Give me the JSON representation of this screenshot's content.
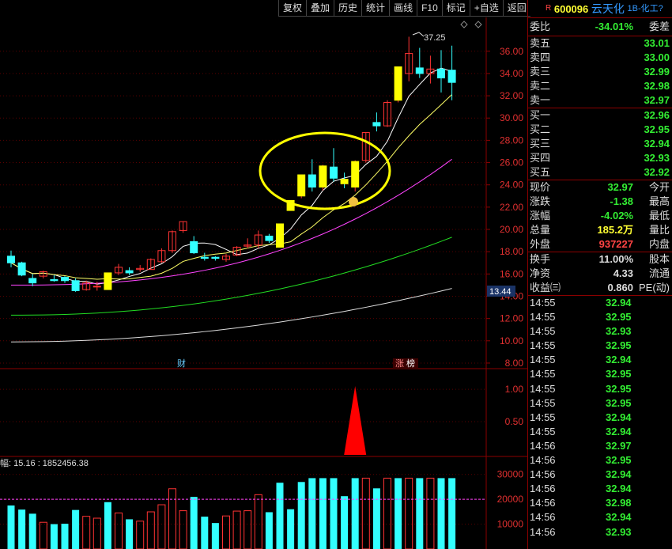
{
  "toolbar": {
    "buttons": [
      "复权",
      "叠加",
      "历史",
      "统计",
      "画线",
      "F10",
      "标记",
      "+自选",
      "返回"
    ]
  },
  "stock": {
    "marker": "R",
    "code": "600096",
    "name": "云天化",
    "tag": "1B-化工?"
  },
  "quote": {
    "weibi": {
      "label": "委比",
      "value": "-34.01%",
      "label2": "委差"
    },
    "asks": [
      {
        "label": "卖五",
        "price": "33.01"
      },
      {
        "label": "卖四",
        "price": "33.00"
      },
      {
        "label": "卖三",
        "price": "32.99"
      },
      {
        "label": "卖二",
        "price": "32.98"
      },
      {
        "label": "卖一",
        "price": "32.97"
      }
    ],
    "bids": [
      {
        "label": "买一",
        "price": "32.96"
      },
      {
        "label": "买二",
        "price": "32.95"
      },
      {
        "label": "买三",
        "price": "32.94"
      },
      {
        "label": "买四",
        "price": "32.93"
      },
      {
        "label": "买五",
        "price": "32.92"
      }
    ],
    "stats1": [
      {
        "label": "现价",
        "value": "32.97",
        "label2": "今开",
        "color": "#33ee33"
      },
      {
        "label": "涨跌",
        "value": "-1.38",
        "label2": "最高",
        "color": "#33ee33"
      },
      {
        "label": "涨幅",
        "value": "-4.02%",
        "label2": "最低",
        "color": "#33ee33"
      },
      {
        "label": "总量",
        "value": "185.2万",
        "label2": "量比",
        "color": "#ffff33"
      },
      {
        "label": "外盘",
        "value": "937227",
        "label2": "内盘",
        "color": "#ff4444"
      }
    ],
    "stats2": [
      {
        "label": "换手",
        "value": "11.00%",
        "label2": "股本",
        "color": "#dddddd"
      },
      {
        "label": "净资",
        "value": "4.33",
        "label2": "流通",
        "color": "#dddddd"
      },
      {
        "label": "收益㈢",
        "value": "0.860",
        "label2": "PE(动)",
        "color": "#dddddd"
      }
    ],
    "ticks": [
      {
        "time": "14:55",
        "price": "32.94"
      },
      {
        "time": "14:55",
        "price": "32.95"
      },
      {
        "time": "14:55",
        "price": "32.93"
      },
      {
        "time": "14:55",
        "price": "32.95"
      },
      {
        "time": "14:55",
        "price": "32.94"
      },
      {
        "time": "14:55",
        "price": "32.95"
      },
      {
        "time": "14:55",
        "price": "32.95"
      },
      {
        "time": "14:55",
        "price": "32.95"
      },
      {
        "time": "14:55",
        "price": "32.94"
      },
      {
        "time": "14:55",
        "price": "32.94"
      },
      {
        "time": "14:56",
        "price": "32.97"
      },
      {
        "time": "14:56",
        "price": "32.95"
      },
      {
        "time": "14:56",
        "price": "32.94"
      },
      {
        "time": "14:56",
        "price": "32.94"
      },
      {
        "time": "14:56",
        "price": "32.98"
      },
      {
        "time": "14:56",
        "price": "32.94"
      },
      {
        "time": "14:56",
        "price": "32.93"
      }
    ]
  },
  "colors": {
    "up": "#ff3333",
    "down": "#33ffff",
    "limit_up": "#ffff00",
    "ma5": "#ffffff",
    "ma10": "#ffff66",
    "ma20": "#ff44ff",
    "ma60": "#22dd22",
    "ma120": "#dddddd",
    "annotation": "#ffff00"
  },
  "chart_data": [
    {
      "type": "candlestick",
      "ylim": [
        7.5,
        37.9
      ],
      "y_ticks": [
        "36.00",
        "34.00",
        "32.00",
        "30.00",
        "28.00",
        "26.00",
        "24.00",
        "22.00",
        "20.00",
        "18.00",
        "16.00",
        "14.00",
        "12.00",
        "10.00",
        "8.00"
      ],
      "current_price_label": "13.44",
      "high_label": "37.25",
      "markers": [
        "财",
        "涨",
        "榜"
      ],
      "candles": [
        {
          "o": 17.6,
          "h": 18.1,
          "c": 17.0,
          "l": 16.6
        },
        {
          "o": 17.0,
          "h": 17.1,
          "c": 15.9,
          "l": 15.8
        },
        {
          "o": 15.6,
          "h": 16.0,
          "c": 15.2,
          "l": 14.9
        },
        {
          "o": 15.8,
          "h": 16.3,
          "c": 16.2,
          "l": 15.6
        },
        {
          "o": 15.5,
          "h": 15.9,
          "c": 15.4,
          "l": 15.3
        },
        {
          "o": 15.7,
          "h": 15.8,
          "c": 15.4,
          "l": 15.2
        },
        {
          "o": 15.4,
          "h": 15.6,
          "c": 14.5,
          "l": 14.4
        },
        {
          "o": 14.6,
          "h": 15.4,
          "c": 15.2,
          "l": 14.5
        },
        {
          "o": 14.9,
          "h": 15.3,
          "c": 14.9,
          "l": 14.5
        },
        {
          "o": 14.6,
          "h": 16.1,
          "c": 16.1,
          "l": 14.6
        },
        {
          "o": 16.1,
          "h": 16.9,
          "c": 16.6,
          "l": 15.9
        },
        {
          "o": 16.3,
          "h": 16.6,
          "c": 16.1,
          "l": 15.9
        },
        {
          "o": 16.4,
          "h": 16.8,
          "c": 16.5,
          "l": 16.2
        },
        {
          "o": 16.4,
          "h": 17.4,
          "c": 17.3,
          "l": 16.4
        },
        {
          "o": 17.1,
          "h": 18.3,
          "c": 18.1,
          "l": 17.0
        },
        {
          "o": 18.1,
          "h": 19.9,
          "c": 19.8,
          "l": 17.9
        },
        {
          "o": 19.9,
          "h": 20.7,
          "c": 20.7,
          "l": 19.7
        },
        {
          "o": 18.9,
          "h": 19.4,
          "c": 17.9,
          "l": 17.8
        },
        {
          "o": 17.5,
          "h": 17.9,
          "c": 17.4,
          "l": 17.2
        },
        {
          "o": 17.5,
          "h": 17.6,
          "c": 17.4,
          "l": 17.2
        },
        {
          "o": 17.3,
          "h": 17.8,
          "c": 17.6,
          "l": 17.1
        },
        {
          "o": 17.7,
          "h": 18.5,
          "c": 18.4,
          "l": 17.6
        },
        {
          "o": 18.5,
          "h": 19.2,
          "c": 18.6,
          "l": 18.3
        },
        {
          "o": 18.6,
          "h": 19.9,
          "c": 19.5,
          "l": 18.3
        },
        {
          "o": 19.4,
          "h": 19.6,
          "c": 19.0,
          "l": 18.8
        },
        {
          "o": 18.4,
          "h": 20.5,
          "c": 20.5,
          "l": 18.4
        },
        {
          "o": 21.7,
          "h": 22.6,
          "c": 22.6,
          "l": 21.7
        },
        {
          "o": 23.0,
          "h": 24.9,
          "c": 24.9,
          "l": 22.8
        },
        {
          "o": 24.9,
          "h": 26.3,
          "c": 23.8,
          "l": 23.4
        },
        {
          "o": 23.8,
          "h": 25.8,
          "c": 25.7,
          "l": 23.5
        },
        {
          "o": 25.6,
          "h": 27.3,
          "c": 24.6,
          "l": 24.3
        },
        {
          "o": 24.5,
          "h": 25.1,
          "c": 24.1,
          "l": 23.7
        },
        {
          "o": 23.8,
          "h": 26.2,
          "c": 26.1,
          "l": 23.4
        },
        {
          "o": 26.2,
          "h": 28.7,
          "c": 28.7,
          "l": 26.0
        },
        {
          "o": 29.6,
          "h": 30.5,
          "c": 29.3,
          "l": 28.8
        },
        {
          "o": 29.3,
          "h": 31.6,
          "c": 31.4,
          "l": 29.2
        },
        {
          "o": 31.6,
          "h": 34.6,
          "c": 34.6,
          "l": 31.4
        },
        {
          "o": 34.0,
          "h": 37.3,
          "c": 35.8,
          "l": 33.3
        },
        {
          "o": 34.5,
          "h": 36.3,
          "c": 34.0,
          "l": 33.6
        },
        {
          "o": 34.0,
          "h": 35.6,
          "c": 34.4,
          "l": 33.1
        },
        {
          "o": 34.4,
          "h": 36.1,
          "c": 33.6,
          "l": 32.3
        },
        {
          "o": 34.3,
          "h": 36.5,
          "c": 33.2,
          "l": 31.6
        }
      ],
      "limit_up_days": [
        9,
        25,
        26,
        27,
        29,
        31,
        32,
        36
      ]
    },
    {
      "type": "signal",
      "y_ticks": [
        "1.00",
        "0.50"
      ],
      "signal_day": 32
    },
    {
      "type": "bar",
      "label": "幅: 15.16 : 1852456.38",
      "y_ticks": [
        "30000",
        "20000",
        "10000"
      ],
      "ylim": [
        0,
        30000
      ]
    }
  ]
}
